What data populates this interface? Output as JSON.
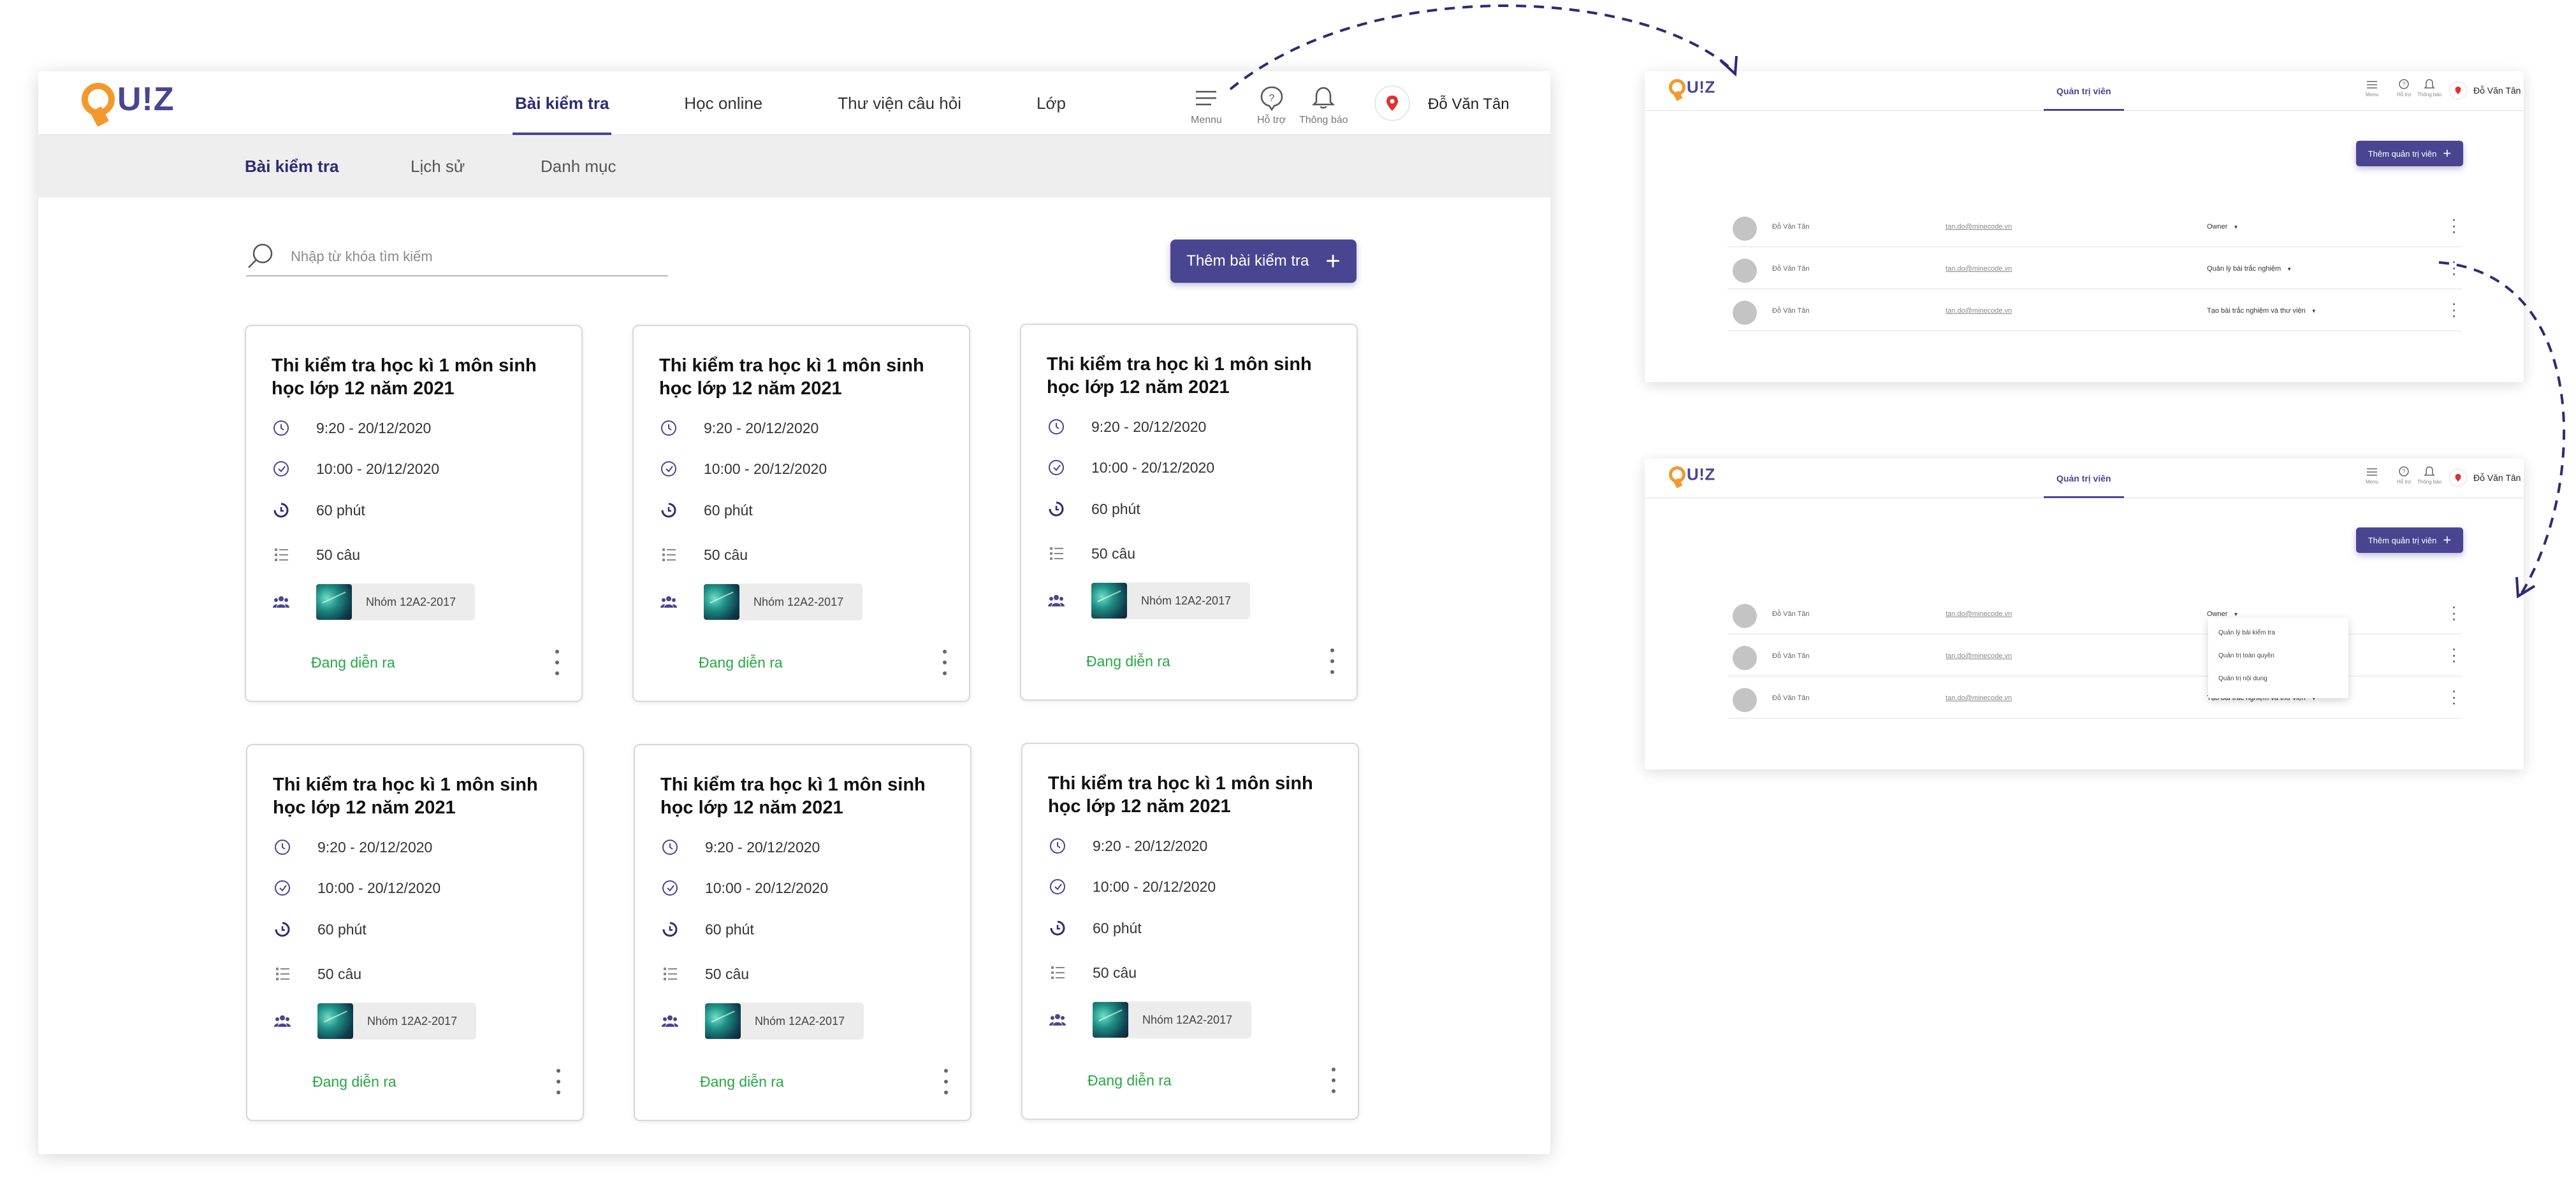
{
  "brand": {
    "logo_text": "U!Z",
    "logo_q": "Q"
  },
  "main": {
    "nav": [
      "Bài kiểm tra",
      "Học online",
      "Thư viện câu hỏi",
      "Lớp"
    ],
    "utils": {
      "menu": "Mennu",
      "support": "Hỗ trợ",
      "notify": "Thông báo"
    },
    "user_name": "Đỗ Văn Tân",
    "subnav": [
      "Bài kiểm tra",
      "Lịch sử",
      "Danh mục"
    ],
    "search": {
      "placeholder": "Nhập từ khóa tìm kiếm"
    },
    "add_button": "Thêm bài kiểm tra",
    "cards": [
      {
        "title": "Thi kiểm tra học kì 1 môn sinh học lớp 12 năm 2021",
        "start": "9:20 - 20/12/2020",
        "end": "10:00 - 20/12/2020",
        "duration": "60 phút",
        "questions": "50 câu",
        "group": "Nhóm  12A2-2017",
        "status": "Đang diễn ra"
      },
      {
        "title": "Thi kiểm tra học kì 1 môn sinh học lớp 12 năm 2021",
        "start": "9:20 - 20/12/2020",
        "end": "10:00 - 20/12/2020",
        "duration": "60 phút",
        "questions": "50 câu",
        "group": "Nhóm  12A2-2017",
        "status": "Đang diễn ra"
      },
      {
        "title": "Thi kiểm tra học kì 1 môn sinh học lớp 12 năm 2021",
        "start": "9:20 - 20/12/2020",
        "end": "10:00 - 20/12/2020",
        "duration": "60 phút",
        "questions": "50 câu",
        "group": "Nhóm  12A2-2017",
        "status": "Đang diễn ra"
      },
      {
        "title": "Thi kiểm tra học kì 1 môn sinh học lớp 12 năm 2021",
        "start": "9:20 - 20/12/2020",
        "end": "10:00 - 20/12/2020",
        "duration": "60 phút",
        "questions": "50 câu",
        "group": "Nhóm  12A2-2017",
        "status": "Đang diễn ra"
      },
      {
        "title": "Thi kiểm tra học kì 1 môn sinh học lớp 12 năm 2021",
        "start": "9:20 - 20/12/2020",
        "end": "10:00 - 20/12/2020",
        "duration": "60 phút",
        "questions": "50 câu",
        "group": "Nhóm  12A2-2017",
        "status": "Đang diễn ra"
      },
      {
        "title": "Thi kiểm tra học kì 1 môn sinh học lớp 12 năm 2021",
        "start": "9:20 - 20/12/2020",
        "end": "10:00 - 20/12/2020",
        "duration": "60 phút",
        "questions": "50 câu",
        "group": "Nhóm  12A2-2017",
        "status": "Đang diễn ra"
      }
    ]
  },
  "admin1": {
    "tab": "Quản trị viên",
    "utils": {
      "menu": "Menu",
      "support": "Hỗ trợ",
      "notify": "Thông báo"
    },
    "user_name": "Đỗ Văn Tân",
    "add_button": "Thêm quản trị viên",
    "rows": [
      {
        "name": "Đỗ Văn Tân",
        "email": "tan.do@minecode.vn",
        "role": "Owner"
      },
      {
        "name": "Đỗ Văn Tân",
        "email": "tan.do@minecode.vn",
        "role": "Quản lý bài trắc nghiệm"
      },
      {
        "name": "Đỗ Văn Tân",
        "email": "tan.do@minecode.vn",
        "role": "Tạo bài trắc nghiệm và thư viện"
      }
    ]
  },
  "admin2": {
    "tab": "Quản trị viên",
    "utils": {
      "menu": "Menu",
      "support": "Hỗ trợ",
      "notify": "Thông báo"
    },
    "user_name": "Đỗ Văn Tân",
    "add_button": "Thêm quản trị viên",
    "rows": [
      {
        "name": "Đỗ Văn Tân",
        "email": "tan.do@minecode.vn",
        "role": "Owner"
      },
      {
        "name": "Đỗ Văn Tân",
        "email": "tan.do@minecode.vn",
        "role": ""
      },
      {
        "name": "Đỗ Văn Tân",
        "email": "tan.do@minecode.vn",
        "role": "Tạo bài trắc nghiệm và thư viện"
      }
    ],
    "dropdown": [
      "Quản lý bài kiểm tra",
      "Quản trị toàn quyền",
      "Quản trị nội dung"
    ]
  },
  "colors": {
    "primary": "#4a4591",
    "accent": "#f2992e",
    "status_green": "#27a844",
    "pin_red": "#e0302f"
  }
}
